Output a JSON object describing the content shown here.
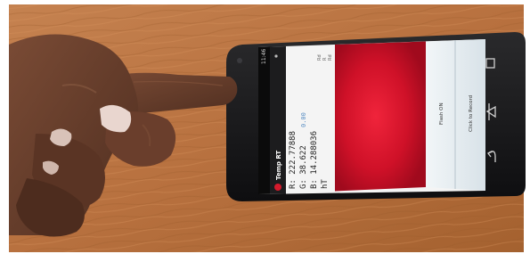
{
  "app": {
    "title": "Temp RT",
    "clock": "11:46",
    "side_letters": [
      "Rd",
      "R",
      "Rd"
    ]
  },
  "readings": {
    "r": "R: 222.77888",
    "g": "G: 38.622",
    "g_extra": "0.00",
    "b": "B: 14.288036",
    "ht": "hT"
  },
  "buttons": {
    "flash": "Flash ON",
    "record": "Click to Record"
  },
  "colors": {
    "sensor_red": "#d3132b",
    "table_wood": "#c07a47",
    "skin": "#6b4230"
  },
  "icons": {
    "app_icon": "red-blood-drop-icon",
    "nav": [
      "back-icon",
      "home-icon",
      "recent-apps-icon"
    ]
  }
}
